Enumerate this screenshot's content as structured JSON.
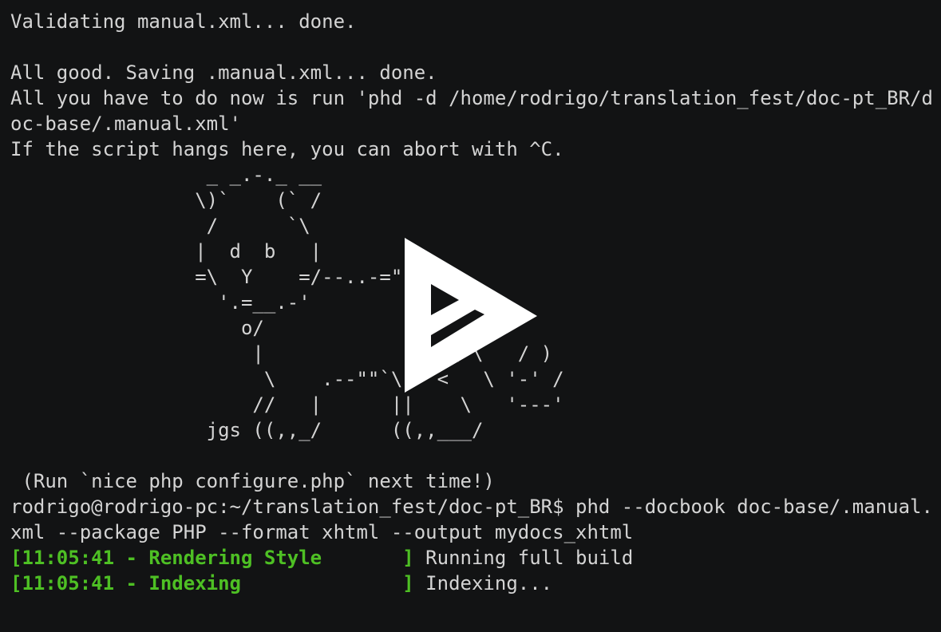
{
  "terminal": {
    "lines": [
      {
        "text": "Validating manual.xml... done."
      },
      {
        "text": ""
      },
      {
        "text": "All good. Saving .manual.xml... done."
      },
      {
        "text": "All you have to do now is run 'phd -d /home/rodrigo/translation_fest/doc-pt_BR/d"
      },
      {
        "text": "oc-base/.manual.xml'"
      },
      {
        "text": "If the script hangs here, you can abort with ^C."
      },
      {
        "text": "                 _ _.-._ __"
      },
      {
        "text": "                \\)`    (` /"
      },
      {
        "text": "                 /      `\\"
      },
      {
        "text": "                |  d  b   |"
      },
      {
        "text": "                =\\  Y    =/--..-=\"\"\"`"
      },
      {
        "text": "                  '.=__.-'"
      },
      {
        "text": "                    o/                  \\"
      },
      {
        "text": "                     |              | \\ \\   / )"
      },
      {
        "text": "                      \\    .--\"\"`\\   <   \\ '-' /"
      },
      {
        "text": "                     //   |      ||    \\   '---'"
      },
      {
        "text": "                 jgs ((,,_/      ((,,___/"
      },
      {
        "text": ""
      },
      {
        "text": " (Run `nice php configure.php` next time!)"
      },
      {
        "text": "rodrigo@rodrigo-pc:~/translation_fest/doc-pt_BR$ phd --docbook doc-base/.manual."
      },
      {
        "text": "xml --package PHP --format xhtml --output mydocs_xhtml"
      }
    ],
    "status_lines": [
      {
        "tag": "[11:05:41 - Rendering Style       ]",
        "msg": " Running full build"
      },
      {
        "tag": "[11:05:41 - Indexing              ]",
        "msg": " Indexing..."
      }
    ]
  },
  "colors": {
    "background": "#121314",
    "text": "#d4d4d4",
    "status_green": "#4ec024",
    "overlay": "#ffffff"
  },
  "overlay": {
    "icon": "asciinema-play-icon"
  }
}
